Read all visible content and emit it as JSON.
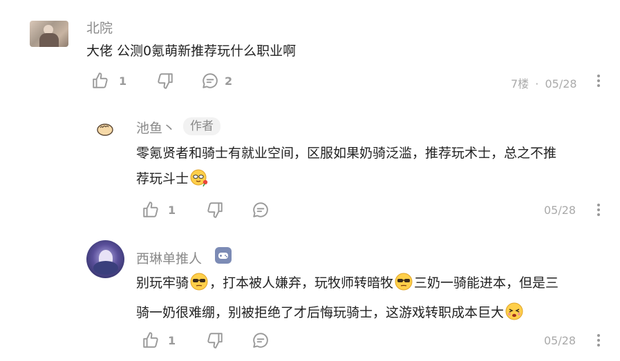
{
  "comments": [
    {
      "user": "北院",
      "text": "大佬 公测0氪萌新推荐玩什么职业啊",
      "likes": "1",
      "replies": "2",
      "floor": "7楼",
      "separator": "·",
      "date": "05/28"
    }
  ],
  "replies": [
    {
      "user": "池鱼丶",
      "badge": "作者",
      "text_line1": "零氪贤者和骑士有就业空间，区服如果奶骑泛滥，推荐玩术士，总之不推",
      "text_line2": "荐玩斗士",
      "likes": "1",
      "date": "05/28"
    },
    {
      "user": "西琳单推人",
      "text_a": "别玩牢骑",
      "text_b": "，打本被人嫌弃，玩牧师转暗牧",
      "text_c": "三奶一骑能进本，但是三",
      "text_line2": "骑一奶很难绷，别被拒绝了才后悔玩骑士，这游戏转职成本巨大",
      "likes": "1",
      "date": "05/28"
    }
  ],
  "icons": {
    "like": "thumbs-up-icon",
    "dislike": "thumbs-down-icon",
    "reply": "comment-bubble-icon",
    "more": "more-vertical-icon",
    "game_badge": "gamepad-icon"
  },
  "colors": {
    "text": "#222222",
    "muted": "#8a8a8a",
    "icon": "#9a9a9a",
    "badge_bg": "#f2f2f2",
    "game_badge": "#7c8bb5"
  }
}
